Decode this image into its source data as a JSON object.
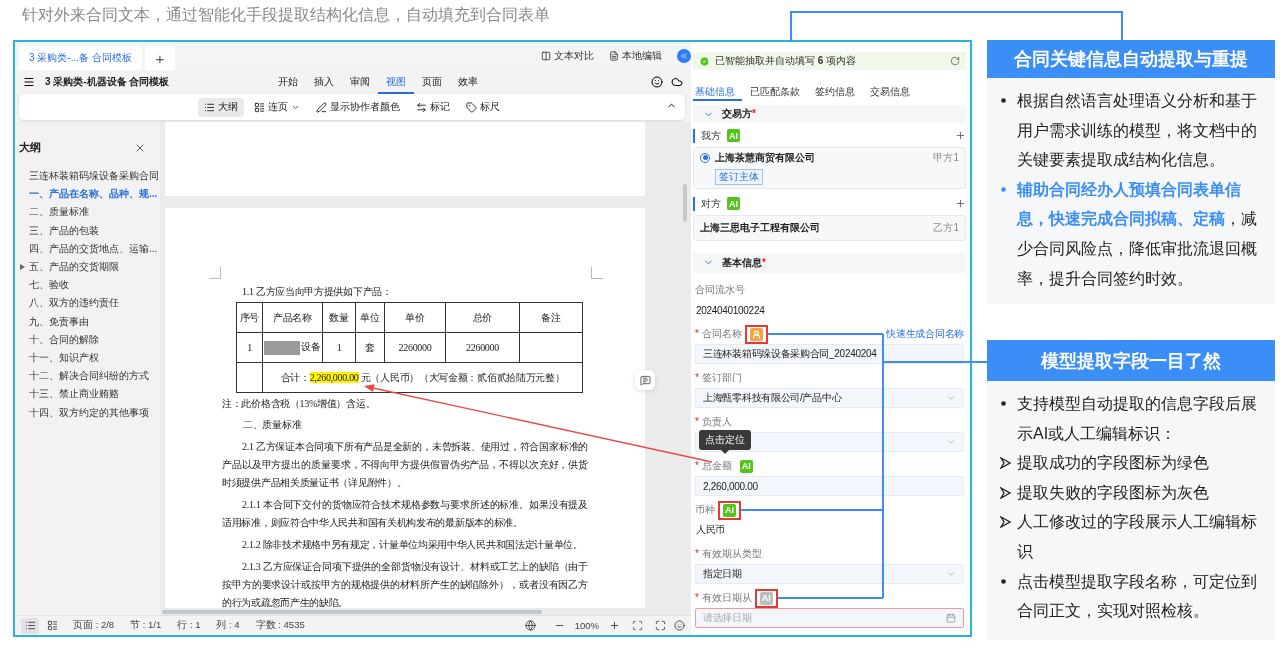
{
  "heading": "针对外来合同文本，通过智能化手段提取结构化信息，自动填充到合同表单",
  "app": {
    "tabs": [
      {
        "label": "3 采购类-...备 合同模板",
        "selected": true
      }
    ],
    "new_tab": "+",
    "actions": [
      {
        "kind": "compare",
        "label": "文本对比"
      },
      {
        "kind": "edit",
        "label": "本地编辑"
      }
    ],
    "document_title": "3 采购类-机器设备 合同模板",
    "menu": [
      {
        "label": "开始",
        "selected": false
      },
      {
        "label": "插入",
        "selected": false
      },
      {
        "label": "审阅",
        "selected": false
      },
      {
        "label": "视图",
        "selected": true
      },
      {
        "label": "页面",
        "selected": false
      },
      {
        "label": "效率",
        "selected": false
      }
    ],
    "toolbar": [
      {
        "kind": "outline",
        "label": "大纲",
        "selected": true,
        "dropdown": false
      },
      {
        "kind": "pages",
        "label": "连页",
        "selected": false,
        "dropdown": true
      },
      {
        "kind": "colors",
        "label": "显示协作者颜色",
        "selected": false,
        "dropdown": false
      },
      {
        "kind": "marks",
        "label": "标记",
        "selected": false,
        "dropdown": false
      },
      {
        "kind": "ruler",
        "label": "标尺",
        "selected": false,
        "dropdown": false
      }
    ],
    "outline": {
      "title": "大纲",
      "items": [
        {
          "label": "三连杯装箱码垛设备采购合同",
          "selected": false,
          "collapsed": false
        },
        {
          "label": "一、产品在名称、品种、规...",
          "selected": true,
          "collapsed": false
        },
        {
          "label": "二、质量标准",
          "selected": false,
          "collapsed": false
        },
        {
          "label": "三、产品的包装",
          "selected": false,
          "collapsed": false
        },
        {
          "label": "四、产品的交货地点、运输...",
          "selected": false,
          "collapsed": false
        },
        {
          "label": "五、产品的交货期限",
          "selected": false,
          "collapsed": true
        },
        {
          "label": "七、验收",
          "selected": false,
          "collapsed": false
        },
        {
          "label": "八、双方的违约责任",
          "selected": false,
          "collapsed": false
        },
        {
          "label": "九、免责事由",
          "selected": false,
          "collapsed": false
        },
        {
          "label": "十、合同的解除",
          "selected": false,
          "collapsed": false
        },
        {
          "label": "十一、知识产权",
          "selected": false,
          "collapsed": false
        },
        {
          "label": "十二、解决合同纠纷的方式",
          "selected": false,
          "collapsed": false
        },
        {
          "label": "十三、禁止商业贿赂",
          "selected": false,
          "collapsed": false
        },
        {
          "label": "十四、双方约定的其他事项",
          "selected": false,
          "collapsed": false
        }
      ]
    },
    "document": {
      "intro": "1.1 乙方应当向甲方提供如下产品：",
      "table": {
        "columns": [
          "序号",
          "产品名称",
          "数量",
          "单位",
          "单价",
          "总价",
          "备注"
        ],
        "rows": [
          {
            "cells": [
              {
                "text": "1",
                "redacted": false
              },
              {
                "text": "设备",
                "redacted": true
              },
              {
                "text": "1",
                "redacted": false
              },
              {
                "text": "套",
                "redacted": false
              },
              {
                "text": "2260000",
                "redacted": false
              },
              {
                "text": "2260000",
                "redacted": false
              }
            ]
          }
        ],
        "total": {
          "label": "合计：",
          "amount": "2,260,000.00",
          "highlighted": true,
          "rest": "元（人民币）（大写金额：贰佰贰拾陆万元整）"
        }
      },
      "note": "注：此价格含税（13%增值）含运。",
      "section_heading": "二、质量标准",
      "paragraphs": [
        "2.1 乙方保证本合同项下所有产品是全新的，未曾拆装、使用过，符合国家标准的产品以及甲方提出的质量要求，不得向甲方提供假冒伪劣产品，不得以次充好，供货时须提供产品相关质量证书（详见附件）。",
        "2.1.1 本合同下交付的货物应符合技术规格参数与要求所述的标准。如果没有提及适用标准，则应符合中华人民共和国有关机构发布的最新版本的标准。",
        "2.1.2 除非技术规格中另有规定，计量单位均采用中华人民共和国法定计量单位。",
        "2.1.3 乙方应保证合同项下提供的全部货物没有设计、材料或工艺上的缺陷（由于按甲方的要求设计或按甲方的规格提供的材料所产生的缺陷除外），或者没有因乙方的行为或疏忽而产生的缺陷。"
      ]
    },
    "status_bar": {
      "items": [
        "页面 : 2/8",
        "节 : 1/1",
        "行 : 1",
        "列 : 4",
        "字数 : 4535"
      ],
      "zoom": "100%"
    }
  },
  "panel": {
    "banner": "已智能抽取并自动填写 **6** 项内容",
    "tabs": [
      {
        "label": "基础信息",
        "selected": true
      },
      {
        "label": "已匹配条款",
        "selected": false
      },
      {
        "label": "签约信息",
        "selected": false
      },
      {
        "label": "交易信息",
        "selected": false
      }
    ],
    "parties_section": {
      "title": "交易方",
      "required_mark": "*"
    },
    "parties": [
      {
        "kind": "radio",
        "label": "我方",
        "badge": {
          "kind": "success",
          "text": "AI"
        },
        "company": "上海茶慧商贸有限公司",
        "role": "甲方1",
        "tag": "签订主体",
        "selected": true
      },
      {
        "kind": "plain",
        "label": "对方",
        "badge": {
          "kind": "success",
          "text": "AI"
        },
        "company": "上海三思电子工程有限公司",
        "role": "乙方1"
      }
    ],
    "basic_section": {
      "title": "基本信息",
      "required_mark": "*"
    },
    "fields": [
      {
        "kind": "text",
        "label": "合同流水号",
        "invalid": false,
        "value": "2024040100224"
      },
      {
        "kind": "input",
        "label": "合同名称",
        "required_mark": "*",
        "annotated": true,
        "invalid": false,
        "badge": {
          "kind": "manual"
        },
        "link": "快速生成合同名称",
        "value": "三连杯装箱码垛设备采购合同_20240204"
      },
      {
        "kind": "select",
        "label": "签订部门",
        "required_mark": "*",
        "invalid": false,
        "value": "上海甄零科技有限公司/产品中心"
      },
      {
        "kind": "select",
        "label": "负责人",
        "required_mark": "*",
        "invalid": false,
        "tooltip": "点击定位"
      },
      {
        "kind": "input",
        "label": "总金额",
        "required_mark": "*",
        "annotated": false,
        "invalid": false,
        "badge": {
          "kind": "success",
          "text": "AI"
        },
        "value": "2,260,000.00"
      },
      {
        "kind": "text",
        "label": "币种",
        "annotated": true,
        "invalid": false,
        "badge": {
          "kind": "success",
          "text": "AI"
        },
        "value": "人民币"
      },
      {
        "kind": "select",
        "label": "有效期从类型",
        "required_mark": "*",
        "invalid": false,
        "value": "指定日期"
      },
      {
        "kind": "date",
        "label": "有效日期从",
        "required_mark": "*",
        "annotated": true,
        "invalid": true,
        "badge": {
          "kind": "failed",
          "text": "AI"
        },
        "placeholder": "请选择日期"
      }
    ]
  },
  "callouts": [
    {
      "title": "合同关键信息自动提取与重提",
      "bullets": [
        {
          "kind": "dot",
          "parts": [
            {
              "text": "根据自然语言处理语义分析和基于用户需求训练的模型，将文档中的关键要素提取成结构化信息。",
              "emphasis": false
            }
          ]
        },
        {
          "kind": "dot",
          "parts": [
            {
              "text": "辅助合同经办人预填合同表单信息，快速完成合同拟稿、定稿",
              "emphasis": true
            },
            {
              "text": "，减少合同风险点，降低审批流退回概率，提升合同签约时效。",
              "emphasis": false
            }
          ]
        }
      ]
    },
    {
      "title": "模型提取字段一目了然",
      "bullets": [
        {
          "kind": "dot",
          "parts": [
            {
              "text": "支持模型自动提取的信息字段后展示AI或人工编辑标识：",
              "emphasis": false
            }
          ]
        },
        {
          "kind": "arrow",
          "parts": [
            {
              "text": "提取成功的字段图标为绿色",
              "emphasis": false
            }
          ]
        },
        {
          "kind": "arrow",
          "parts": [
            {
              "text": "提取失败的字段图标为灰色",
              "emphasis": false
            }
          ]
        },
        {
          "kind": "arrow",
          "parts": [
            {
              "text": "人工修改过的字段展示人工编辑标识",
              "emphasis": false
            }
          ]
        },
        {
          "kind": "dot",
          "parts": [
            {
              "text": "点击模型提取字段名称，可定位到合同正文，实现对照检核。",
              "emphasis": false
            }
          ]
        }
      ]
    }
  ]
}
